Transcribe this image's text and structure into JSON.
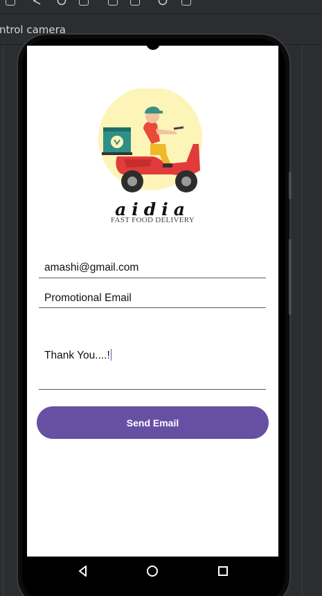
{
  "ide": {
    "title": "ntrol camera"
  },
  "app": {
    "brand": "aidia",
    "tagline": "FAST FOOD DELIVERY",
    "email_value": "amashi@gmail.com",
    "subject_value": "Promotional Email",
    "message_value": "Thank You....!",
    "send_label": "Send Email",
    "accent": "#6750a4"
  },
  "nav": {
    "back_icon": "back-icon",
    "home_icon": "home-icon",
    "recents_icon": "recents-icon"
  }
}
